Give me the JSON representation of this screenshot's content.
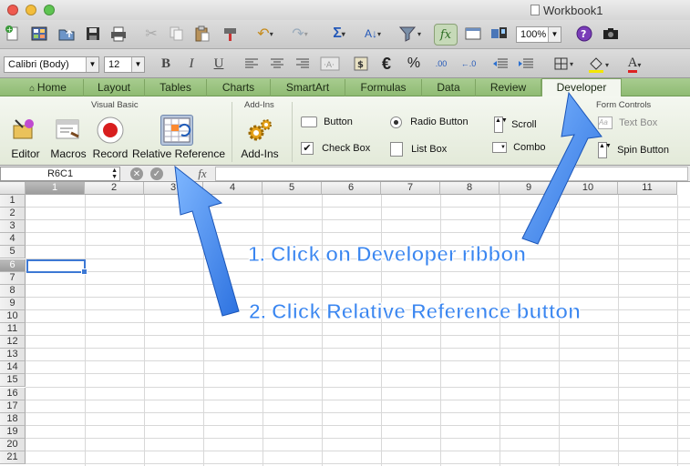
{
  "window": {
    "title": "Workbook1"
  },
  "toolbar": {
    "zoom": "100%",
    "font_name": "Calibri (Body)",
    "font_size": "12",
    "bold": "B",
    "italic": "I",
    "underline": "U",
    "currency": "€",
    "percent": "%",
    "dec_inc": ".00",
    "font_color_letter": "A"
  },
  "tabs": [
    "Home",
    "Layout",
    "Tables",
    "Charts",
    "SmartArt",
    "Formulas",
    "Data",
    "Review",
    "Developer"
  ],
  "ribbon": {
    "groups": {
      "visual_basic": "Visual Basic",
      "add_ins": "Add-Ins",
      "form_controls": "Form Controls"
    },
    "buttons": {
      "editor": "Editor",
      "macros": "Macros",
      "record": "Record",
      "relative_reference": "Relative Reference",
      "add_ins": "Add-Ins"
    },
    "controls": {
      "button": "Button",
      "check_box": "Check Box",
      "radio_button": "Radio Button",
      "list_box": "List Box",
      "scroll": "Scroll",
      "combo": "Combo",
      "text_box": "Text Box",
      "spin_button": "Spin Button"
    }
  },
  "formula_bar": {
    "name_box": "R6C1",
    "fx": "fx"
  },
  "sheet": {
    "columns": [
      "1",
      "2",
      "3",
      "4",
      "5",
      "6",
      "7",
      "8",
      "9",
      "10",
      "11"
    ],
    "rows": [
      "1",
      "2",
      "3",
      "4",
      "5",
      "6",
      "7",
      "8",
      "9",
      "10",
      "11",
      "12",
      "13",
      "14",
      "15",
      "16",
      "17",
      "18",
      "19",
      "20",
      "21"
    ],
    "selected_row": "6",
    "selected_col": "1"
  },
  "annotations": {
    "step1": "1. Click on Developer ribbon",
    "step2": "2. Click Relative Reference button"
  },
  "colors": {
    "tab_bar": "#8fbb73",
    "arrow": "#3a86f0",
    "selection": "#3d78d4"
  }
}
